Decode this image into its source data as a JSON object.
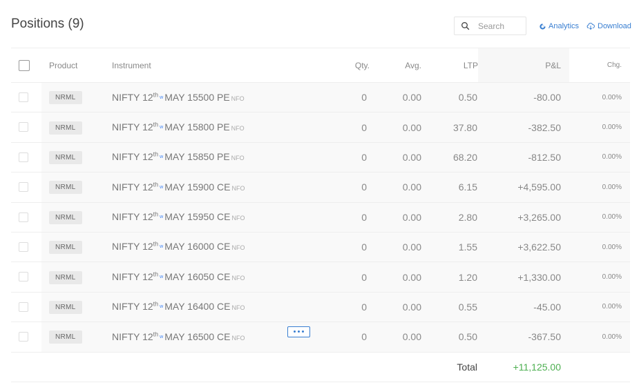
{
  "header": {
    "title": "Positions (9)",
    "search_placeholder": "Search",
    "analytics_label": "Analytics",
    "download_label": "Download"
  },
  "columns": {
    "product": "Product",
    "instrument": "Instrument",
    "qty": "Qty.",
    "avg": "Avg.",
    "ltp": "LTP",
    "pnl": "P&L",
    "chg": "Chg."
  },
  "rows": [
    {
      "product": "NRML",
      "symbol": "NIFTY 12",
      "sup": "th",
      "weekly": "w",
      "contract": "MAY 15500 PE",
      "exchange": "NFO",
      "qty": "0",
      "avg": "0.00",
      "ltp": "0.50",
      "pnl": "-80.00",
      "chg": "0.00%"
    },
    {
      "product": "NRML",
      "symbol": "NIFTY 12",
      "sup": "th",
      "weekly": "w",
      "contract": "MAY 15800 PE",
      "exchange": "NFO",
      "qty": "0",
      "avg": "0.00",
      "ltp": "37.80",
      "pnl": "-382.50",
      "chg": "0.00%"
    },
    {
      "product": "NRML",
      "symbol": "NIFTY 12",
      "sup": "th",
      "weekly": "w",
      "contract": "MAY 15850 PE",
      "exchange": "NFO",
      "qty": "0",
      "avg": "0.00",
      "ltp": "68.20",
      "pnl": "-812.50",
      "chg": "0.00%"
    },
    {
      "product": "NRML",
      "symbol": "NIFTY 12",
      "sup": "th",
      "weekly": "w",
      "contract": "MAY 15900 CE",
      "exchange": "NFO",
      "qty": "0",
      "avg": "0.00",
      "ltp": "6.15",
      "pnl": "+4,595.00",
      "chg": "0.00%"
    },
    {
      "product": "NRML",
      "symbol": "NIFTY 12",
      "sup": "th",
      "weekly": "w",
      "contract": "MAY 15950 CE",
      "exchange": "NFO",
      "qty": "0",
      "avg": "0.00",
      "ltp": "2.80",
      "pnl": "+3,265.00",
      "chg": "0.00%"
    },
    {
      "product": "NRML",
      "symbol": "NIFTY 12",
      "sup": "th",
      "weekly": "w",
      "contract": "MAY 16000 CE",
      "exchange": "NFO",
      "qty": "0",
      "avg": "0.00",
      "ltp": "1.55",
      "pnl": "+3,622.50",
      "chg": "0.00%"
    },
    {
      "product": "NRML",
      "symbol": "NIFTY 12",
      "sup": "th",
      "weekly": "w",
      "contract": "MAY 16050 CE",
      "exchange": "NFO",
      "qty": "0",
      "avg": "0.00",
      "ltp": "1.20",
      "pnl": "+1,330.00",
      "chg": "0.00%"
    },
    {
      "product": "NRML",
      "symbol": "NIFTY 12",
      "sup": "th",
      "weekly": "w",
      "contract": "MAY 16400 CE",
      "exchange": "NFO",
      "qty": "0",
      "avg": "0.00",
      "ltp": "0.55",
      "pnl": "-45.00",
      "chg": "0.00%"
    },
    {
      "product": "NRML",
      "symbol": "NIFTY 12",
      "sup": "th",
      "weekly": "w",
      "contract": "MAY 16500 CE",
      "exchange": "NFO",
      "qty": "0",
      "avg": "0.00",
      "ltp": "0.50",
      "pnl": "-367.50",
      "chg": "0.00%"
    }
  ],
  "total": {
    "label": "Total",
    "value": "+11,125.00",
    "value_color": "#4caf50"
  },
  "icons": {
    "search": "search-icon",
    "analytics": "analytics-donut-icon",
    "download": "cloud-download-icon",
    "more": "more-options-icon"
  },
  "colors": {
    "accent": "#387ed1",
    "profit": "#4caf50"
  }
}
